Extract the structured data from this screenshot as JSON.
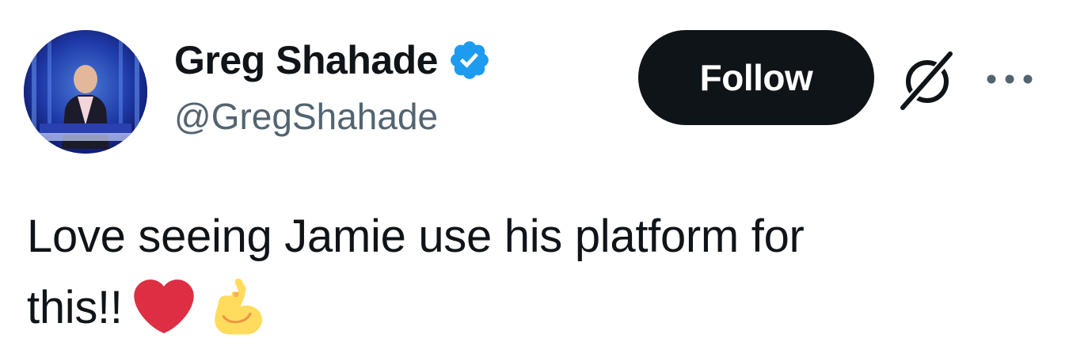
{
  "author": {
    "display_name": "Greg Shahade",
    "handle": "@GregShahade",
    "verified_icon": "verified-badge-icon",
    "verified_color": "#1d9bf0"
  },
  "actions": {
    "follow_label": "Follow",
    "grok_icon": "grok-icon",
    "more_icon": "more-dots-icon"
  },
  "tweet": {
    "text_line1": "Love seeing Jamie use his platform for",
    "text_line2": "this!!",
    "emojis": [
      "red-heart-emoji",
      "flexed-biceps-emoji"
    ]
  },
  "colors": {
    "text_primary": "#0f1419",
    "text_secondary": "#536471",
    "button_bg": "#0f1419",
    "heart": "#dd2e44",
    "biceps": "#ffdc5d"
  }
}
